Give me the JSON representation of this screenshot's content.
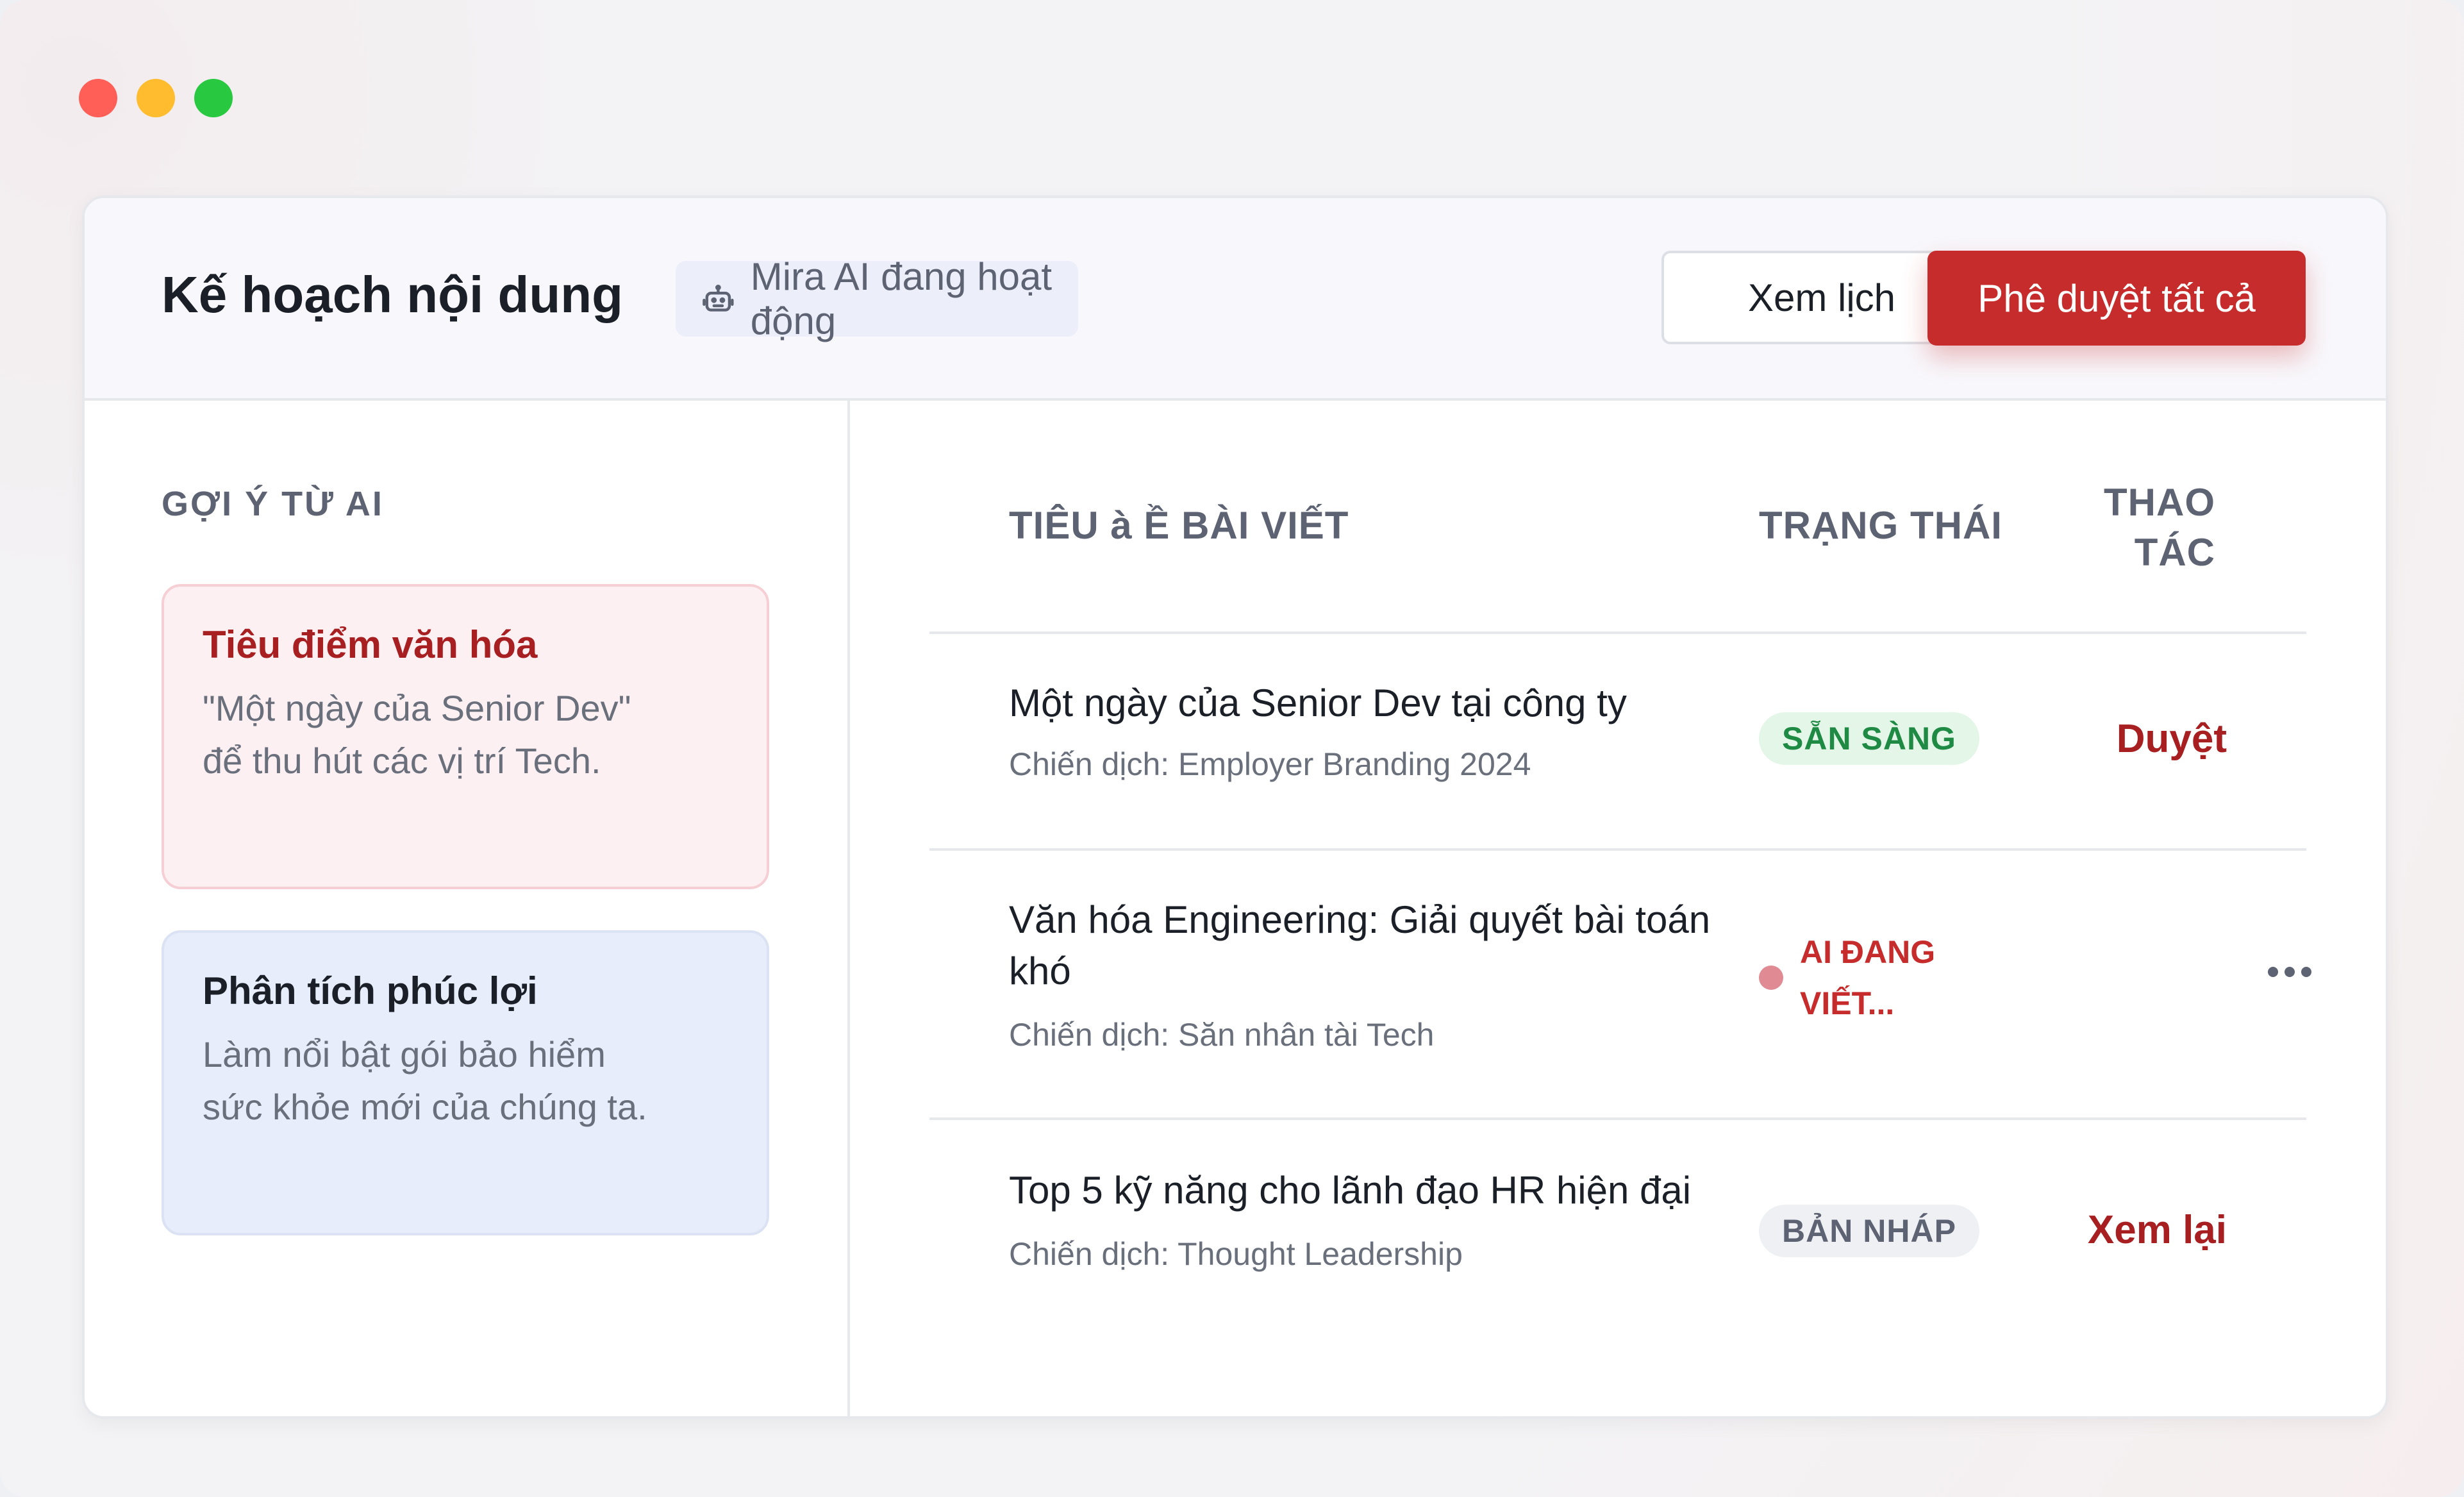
{
  "window": {
    "controls": [
      "close",
      "minimize",
      "maximize"
    ]
  },
  "header": {
    "title": "Kế hoạch nội dung",
    "ai_status": {
      "icon": "robot-icon",
      "text": "Mira AI đang hoạt động"
    },
    "view_calendar_label": "Xem lịch",
    "approve_all_label": "Phê duyệt tất cả"
  },
  "sidebar": {
    "section_label": "GỢI Ý TỪ AI",
    "suggestions": [
      {
        "title": "Tiêu điểm văn hóa",
        "description": "\"Một ngày của Senior Dev\" để thu hút các vị trí Tech."
      },
      {
        "title": "Phân tích phúc lợi",
        "description": "Làm nổi bật gói bảo hiểm sức khỏe mới của chúng ta."
      }
    ]
  },
  "table": {
    "headers": {
      "title": "TIÊU à Ề BÀI VIẾT",
      "status": "TRẠNG THÁI",
      "action": "THAO TÁC"
    },
    "rows": [
      {
        "title": "Một ngày của Senior Dev tại công ty",
        "campaign": "Chiến dịch: Employer Branding 2024",
        "status": "SẴN SÀNG",
        "action": "Duyệt"
      },
      {
        "title": "Văn hóa Engineering: Giải quyết bài toán khó",
        "campaign": "Chiến dịch: Săn nhân tài Tech",
        "status": "AI ĐANG VIẾT...",
        "action_icon": "more-horizontal-icon"
      },
      {
        "title": "Top 5 kỹ năng cho lãnh đạo HR hiện đại",
        "campaign": "Chiến dịch: Thought Leadership",
        "status": "BẢN NHÁP",
        "action": "Xem lại"
      }
    ]
  },
  "colors": {
    "accent": "#c72c2c",
    "accent_text": "#a81f22",
    "ready_green": "#1f8a44",
    "ready_bg": "#e3f6e8",
    "draft_bg": "#eef0f3"
  }
}
